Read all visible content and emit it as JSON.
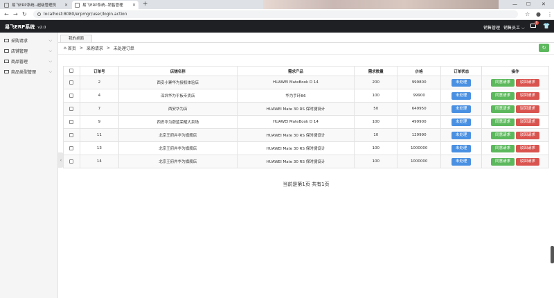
{
  "browser": {
    "tabs": [
      {
        "title": "易飞ERP系统--超级管理员"
      },
      {
        "title": "易飞ERP系统--销售管理"
      }
    ],
    "url": "localhost:8080/erpmgr/user/login.action"
  },
  "header": {
    "brand": "易飞ERP系统",
    "version": "v2.0",
    "dept": "销售管理",
    "user": "销售员工",
    "mail_badge": "0"
  },
  "sidebar": {
    "items": [
      {
        "label": "采购请求"
      },
      {
        "label": "店铺管理"
      },
      {
        "label": "商品管理"
      },
      {
        "label": "商品类型管理"
      }
    ]
  },
  "content": {
    "tab": "我的桌面",
    "breadcrumb": [
      "首页",
      "采购请求",
      "未处理订单"
    ]
  },
  "table": {
    "headers": [
      "订单号",
      "店铺名称",
      "需求产品",
      "需求数量",
      "价格",
      "订单状态",
      "操作"
    ],
    "status_label": "未处理",
    "approve_label": "同意请求",
    "reject_label": "驳回请求",
    "rows": [
      {
        "id": "2",
        "store": "西安小寨华为授权体验店",
        "product": "HUAWEI MateBook D 14",
        "qty": "200",
        "price": "999800"
      },
      {
        "id": "4",
        "store": "深圳华为平板专卖店",
        "product": "华为手环B6",
        "qty": "100",
        "price": "99900"
      },
      {
        "id": "7",
        "store": "西安华为店",
        "product": "HUAWEI Mate 30 RS 保时捷设计",
        "qty": "50",
        "price": "649950"
      },
      {
        "id": "9",
        "store": "西安华为蔚蓝荣耀大卖场",
        "product": "HUAWEI MateBook D 14",
        "qty": "100",
        "price": "499900"
      },
      {
        "id": "11",
        "store": "北京王府井华为旗舰店",
        "product": "HUAWEI Mate 30 RS 保时捷设计",
        "qty": "10",
        "price": "129990"
      },
      {
        "id": "13",
        "store": "北京王府井华为旗舰店",
        "product": "HUAWEI Mate 30 RS 保时捷设计",
        "qty": "100",
        "price": "1000000"
      },
      {
        "id": "14",
        "store": "北京王府井华为旗舰店",
        "product": "HUAWEI Mate 30 RS 保时捷设计",
        "qty": "100",
        "price": "1000000"
      }
    ]
  },
  "pager": "当前是第1页 共有1页"
}
